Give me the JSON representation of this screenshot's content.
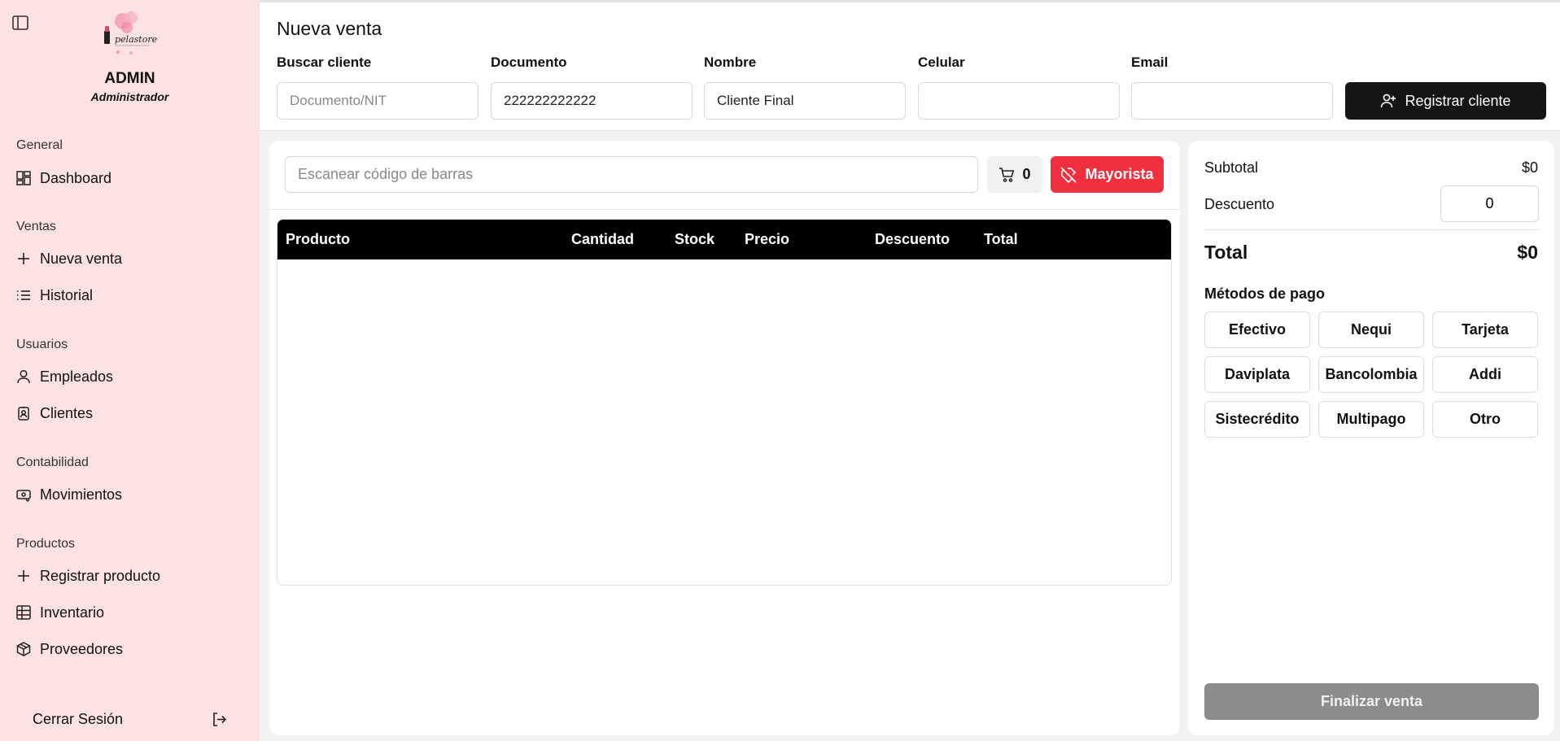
{
  "sidebar": {
    "user_name": "ADMIN",
    "user_role": "Administrador",
    "sections": {
      "general": "General",
      "ventas": "Ventas",
      "usuarios": "Usuarios",
      "contabilidad": "Contabilidad",
      "productos": "Productos"
    },
    "items": {
      "dashboard": "Dashboard",
      "nueva_venta": "Nueva venta",
      "historial": "Historial",
      "empleados": "Empleados",
      "clientes": "Clientes",
      "movimientos": "Movimientos",
      "registrar_producto": "Registrar producto",
      "inventario": "Inventario",
      "proveedores": "Proveedores"
    },
    "logout": "Cerrar Sesión",
    "logo_text": "pelastore"
  },
  "header": {
    "title": "Nueva venta",
    "fields": {
      "buscar_label": "Buscar cliente",
      "buscar_placeholder": "Documento/NIT",
      "documento_label": "Documento",
      "documento_value": "222222222222",
      "nombre_label": "Nombre",
      "nombre_value": "Cliente Final",
      "celular_label": "Celular",
      "celular_value": "",
      "email_label": "Email",
      "email_value": ""
    },
    "register_button": "Registrar cliente"
  },
  "cart": {
    "barcode_placeholder": "Escanear código de barras",
    "cart_count": "0",
    "mayorista_button": "Mayorista",
    "columns": [
      "Producto",
      "Cantidad",
      "Stock",
      "Precio",
      "Descuento",
      "Total"
    ]
  },
  "summary": {
    "subtotal_label": "Subtotal",
    "subtotal_value": "$0",
    "descuento_label": "Descuento",
    "descuento_value": "0",
    "total_label": "Total",
    "total_value": "$0",
    "payment_title": "Métodos de pago",
    "payment_methods": [
      "Efectivo",
      "Nequi",
      "Tarjeta",
      "Daviplata",
      "Bancolombia",
      "Addi",
      "Sistecrédito",
      "Multipago",
      "Otro"
    ],
    "finish_button": "Finalizar venta"
  },
  "colors": {
    "sidebar_bg": "#fde2e4",
    "mayorista": "#f0303f",
    "dark_button": "#151515",
    "finish_disabled": "#8c8c8c"
  }
}
